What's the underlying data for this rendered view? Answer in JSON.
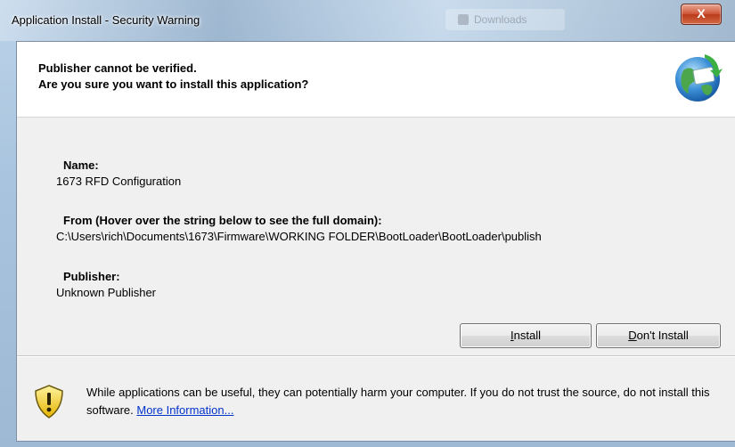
{
  "window": {
    "title": "Application Install - Security Warning",
    "background_tab": "Downloads",
    "close_label": "X"
  },
  "header": {
    "line1": "Publisher cannot be verified.",
    "line2": "Are you sure you want to install this application?",
    "icon": "globe-install-icon"
  },
  "details": {
    "name_label": "Name:",
    "name_value": "1673 RFD Configuration",
    "from_label": "From (Hover over the string below to see the full domain):",
    "from_value": "C:\\Users\\rich\\Documents\\1673\\Firmware\\WORKING FOLDER\\BootLoader\\BootLoader\\publish",
    "publisher_label": "Publisher:",
    "publisher_value": "Unknown Publisher"
  },
  "buttons": {
    "install_prefix": "I",
    "install_rest": "nstall",
    "dont_prefix": "D",
    "dont_rest": "on't Install"
  },
  "warning": {
    "icon": "shield-warning-icon",
    "text": "While applications can be useful, they can potentially harm your computer. If you do not trust the source, do not install this software. ",
    "link": "More Information..."
  },
  "colors": {
    "link": "#0033cc",
    "close_button": "#c9482a"
  }
}
